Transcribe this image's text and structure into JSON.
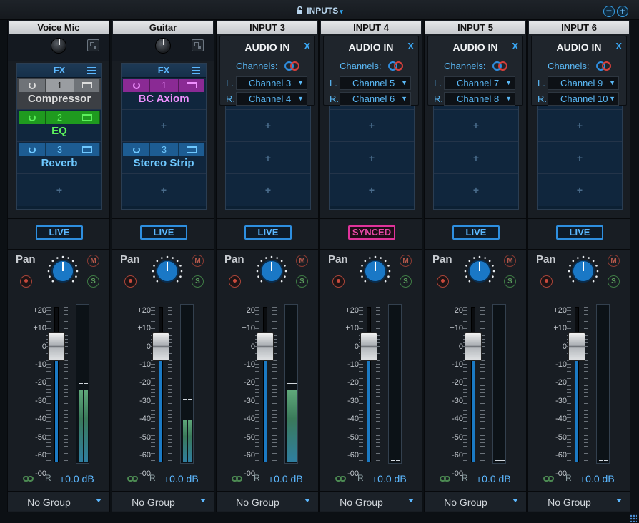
{
  "window": {
    "title": "INPUTS",
    "caret": "▾",
    "zoom_out": "−",
    "zoom_in": "+"
  },
  "channels": [
    {
      "name": "Voice Mic",
      "mode": "fx",
      "fx_label": "FX",
      "inserts": [
        {
          "num": "1",
          "name": "Compressor",
          "color": "#6f7378",
          "text": "#dcdcdc"
        },
        {
          "num": "2",
          "name": "EQ",
          "color": "#1f9a1f",
          "text": "#5cf05c"
        },
        {
          "num": "3",
          "name": "Reverb",
          "color": "#1d5c92",
          "text": "#6ec8ff"
        }
      ],
      "empty_slot": "+",
      "status": "LIVE",
      "pan_label": "Pan",
      "mute": "M",
      "solo": "S",
      "scale": [
        "+20",
        "+10",
        "0",
        "-10",
        "-20",
        "-30",
        "-40",
        "-50",
        "-60",
        "-00"
      ],
      "fader_db": 0,
      "meter_level": 0.46,
      "meter_peak": 0.5,
      "link_r": "R",
      "gain": "+0.0 dB",
      "group": "No Group"
    },
    {
      "name": "Guitar",
      "mode": "fx",
      "fx_label": "FX",
      "inserts": [
        {
          "num": "1",
          "name": "BC Axiom",
          "color": "#8a2a94",
          "text": "#f090ff"
        },
        {
          "num": "",
          "name": "",
          "color": "",
          "text": ""
        },
        {
          "num": "3",
          "name": "Stereo Strip",
          "color": "#1d5c92",
          "text": "#6ec8ff"
        }
      ],
      "empty_slot": "+",
      "status": "LIVE",
      "pan_label": "Pan",
      "mute": "M",
      "solo": "S",
      "scale": [
        "+20",
        "+10",
        "0",
        "-10",
        "-20",
        "-30",
        "-40",
        "-50",
        "-60",
        "-00"
      ],
      "fader_db": 0,
      "meter_level": 0.27,
      "meter_peak": 0.4,
      "link_r": "R",
      "gain": "+0.0 dB",
      "group": "No Group"
    },
    {
      "name": "INPUT 3",
      "mode": "audioin",
      "audio_in": "AUDIO IN",
      "close": "X",
      "channels_label": "Channels:",
      "left": "L.",
      "right": "R.",
      "left_channel": "Channel 3",
      "right_channel": "Channel 4",
      "empty_slot": "+",
      "status": "LIVE",
      "pan_label": "Pan",
      "mute": "M",
      "solo": "S",
      "scale": [
        "+20",
        "+10",
        "0",
        "-10",
        "-20",
        "-30",
        "-40",
        "-50",
        "-60",
        "-00"
      ],
      "fader_db": 0,
      "meter_level": 0.46,
      "meter_peak": 0.5,
      "link_r": "R",
      "gain": "+0.0 dB",
      "group": "No Group"
    },
    {
      "name": "INPUT 4",
      "mode": "audioin",
      "audio_in": "AUDIO IN",
      "close": "X",
      "channels_label": "Channels:",
      "left": "L.",
      "right": "R.",
      "left_channel": "Channel 5",
      "right_channel": "Channel 6",
      "empty_slot": "+",
      "status": "SYNCED",
      "pan_label": "Pan",
      "mute": "M",
      "solo": "S",
      "scale": [
        "+20",
        "+10",
        "0",
        "-10",
        "-20",
        "-30",
        "-40",
        "-50",
        "-60",
        "-00"
      ],
      "fader_db": 0,
      "meter_level": 0,
      "meter_peak": 0,
      "link_r": "R",
      "gain": "+0.0 dB",
      "group": "No Group"
    },
    {
      "name": "INPUT 5",
      "mode": "audioin",
      "audio_in": "AUDIO IN",
      "close": "X",
      "channels_label": "Channels:",
      "left": "L.",
      "right": "R.",
      "left_channel": "Channel 7",
      "right_channel": "Channel 8",
      "empty_slot": "+",
      "status": "LIVE",
      "pan_label": "Pan",
      "mute": "M",
      "solo": "S",
      "scale": [
        "+20",
        "+10",
        "0",
        "-10",
        "-20",
        "-30",
        "-40",
        "-50",
        "-60",
        "-00"
      ],
      "fader_db": 0,
      "meter_level": 0,
      "meter_peak": 0,
      "link_r": "R",
      "gain": "+0.0 dB",
      "group": "No Group"
    },
    {
      "name": "INPUT 6",
      "mode": "audioin",
      "audio_in": "AUDIO IN",
      "close": "X",
      "channels_label": "Channels:",
      "left": "L.",
      "right": "R.",
      "left_channel": "Channel 9",
      "right_channel": "Channel 10",
      "empty_slot": "+",
      "status": "LIVE",
      "pan_label": "Pan",
      "mute": "M",
      "solo": "S",
      "scale": [
        "+20",
        "+10",
        "0",
        "-10",
        "-20",
        "-30",
        "-40",
        "-50",
        "-60",
        "-00"
      ],
      "fader_db": 0,
      "meter_level": 0,
      "meter_peak": 0,
      "link_r": "R",
      "gain": "+0.0 dB",
      "group": "No Group"
    }
  ],
  "colors": {
    "accent": "#2e8fe0",
    "synced": "#e0339b",
    "mute": "#b05040",
    "solo": "#4c8a52",
    "record": "#b05040"
  }
}
